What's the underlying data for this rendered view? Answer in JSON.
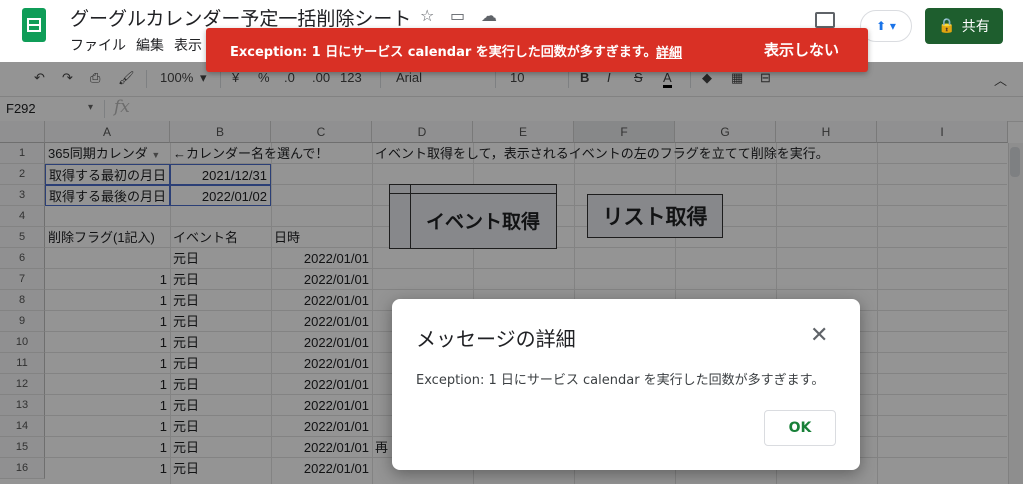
{
  "header": {
    "title": "グーグルカレンダー予定一括削除シート",
    "menu": [
      "ファイル",
      "編集",
      "表示"
    ],
    "share_label": "共有"
  },
  "toolbar": {
    "zoom": "100%",
    "currency": "¥",
    "percent": "%",
    "dec_decrease": ".0",
    "dec_increase": ".00",
    "format_more": "123",
    "font": "Arial",
    "font_size": "10",
    "bold": "B",
    "italic": "I",
    "strike": "S",
    "text_color": "A"
  },
  "formula_bar": {
    "name_box": "F292",
    "fx": "fx"
  },
  "grid": {
    "columns": [
      "A",
      "B",
      "C",
      "D",
      "E",
      "F",
      "G",
      "H",
      "I"
    ],
    "rows": [
      "1",
      "2",
      "3",
      "4",
      "5",
      "6",
      "7",
      "8",
      "9",
      "10",
      "11",
      "12",
      "13",
      "14",
      "15",
      "16"
    ],
    "a1": "365同期カレンダ",
    "b1": "←カレンダー名を選んで！",
    "d1": "イベント取得をして，表示されるイベントの左のフラグを立てて削除を実行。",
    "a2": "取得する最初の月日",
    "b2": "2021/12/31",
    "a3": "取得する最後の月日",
    "b3": "2022/01/02",
    "a5": "削除フラグ(1記入)",
    "b5": "イベント名",
    "c5": "日時",
    "data_rows": [
      {
        "flag": "",
        "name": "元日",
        "date": "2022/01/01"
      },
      {
        "flag": "1",
        "name": "元日",
        "date": "2022/01/01"
      },
      {
        "flag": "1",
        "name": "元日",
        "date": "2022/01/01"
      },
      {
        "flag": "1",
        "name": "元日",
        "date": "2022/01/01"
      },
      {
        "flag": "1",
        "name": "元日",
        "date": "2022/01/01"
      },
      {
        "flag": "1",
        "name": "元日",
        "date": "2022/01/01"
      },
      {
        "flag": "1",
        "name": "元日",
        "date": "2022/01/01"
      },
      {
        "flag": "1",
        "name": "元日",
        "date": "2022/01/01"
      },
      {
        "flag": "1",
        "name": "元日",
        "date": "2022/01/01"
      },
      {
        "flag": "1",
        "name": "元日",
        "date": "2022/01/01"
      },
      {
        "flag": "1",
        "name": "元日",
        "date": "2022/01/01"
      }
    ],
    "d15": "再",
    "event_button": "イベント取得",
    "list_button": "リスト取得"
  },
  "banner": {
    "message": "Exception: 1 日にサービス calendar を実行した回数が多すぎます。",
    "detail_link": "詳細",
    "dismiss": "表示しない",
    "color": "#d93025"
  },
  "dialog": {
    "title": "メッセージの詳細",
    "body": "Exception: 1 日にサービス calendar を実行した回数が多すぎます。",
    "ok": "OK",
    "close_icon": "close-icon"
  }
}
